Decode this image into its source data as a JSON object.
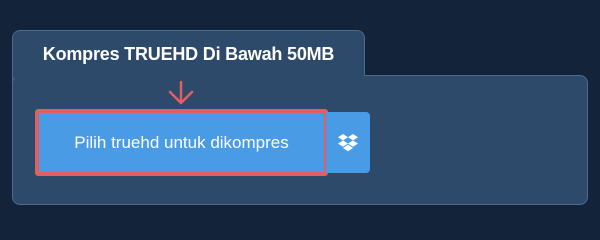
{
  "panel": {
    "title": "Kompres TRUEHD Di Bawah 50MB"
  },
  "upload": {
    "label": "Pilih truehd untuk dikompres"
  },
  "icons": {
    "arrow": "arrow-down-icon",
    "dropbox": "dropbox-icon"
  },
  "colors": {
    "background": "#12233a",
    "panel": "#2e4a6b",
    "button": "#4a9be6",
    "highlight": "#e05f62"
  }
}
